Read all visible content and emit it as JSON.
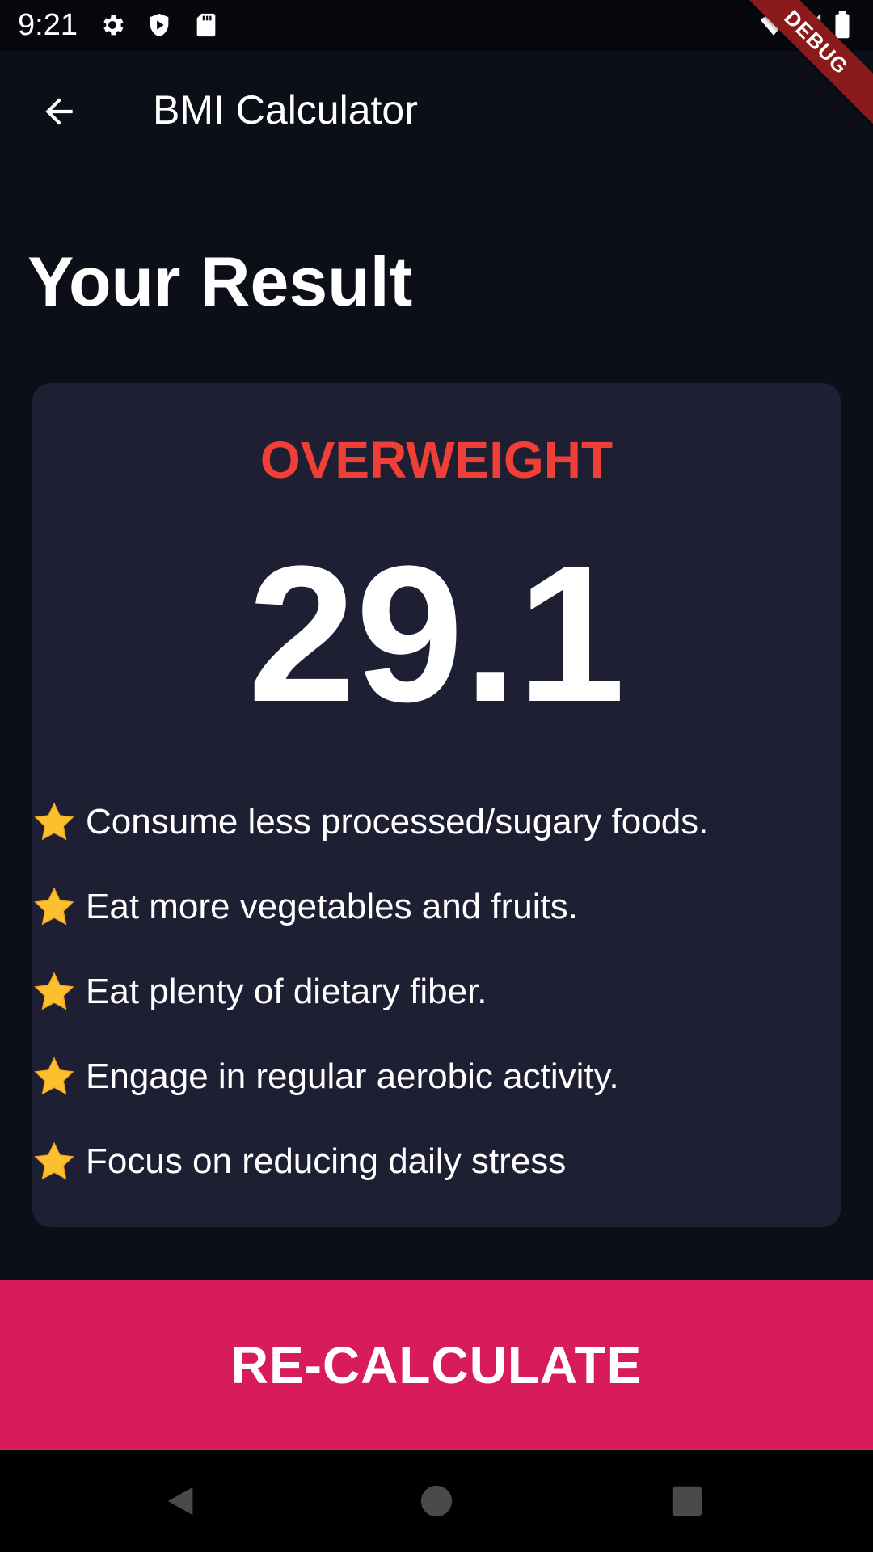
{
  "colors": {
    "background": "#0d0f18",
    "card": "#1e1f33",
    "category": "#ef3f36",
    "button": "#d81b5c",
    "text": "#ffffff"
  },
  "status_bar": {
    "time": "9:21",
    "icons": [
      "settings-icon",
      "shield-icon",
      "sd-card-icon",
      "wifi-icon",
      "signal-icon",
      "battery-icon"
    ]
  },
  "debug_banner": {
    "label": "DEBUG"
  },
  "app_bar": {
    "back_icon": "arrow-back-icon",
    "title": "BMI Calculator"
  },
  "page": {
    "title": "Your Result"
  },
  "result": {
    "category": "OVERWEIGHT",
    "bmi": "29.1",
    "tips": [
      {
        "icon": "star-icon",
        "text": "Consume less processed/sugary foods."
      },
      {
        "icon": "star-icon",
        "text": "Eat more vegetables and fruits."
      },
      {
        "icon": "star-icon",
        "text": "Eat plenty of dietary fiber."
      },
      {
        "icon": "star-icon",
        "text": "Engage in regular aerobic activity."
      },
      {
        "icon": "star-icon",
        "text": "Focus on reducing daily stress"
      }
    ]
  },
  "button": {
    "label": "RE-CALCULATE"
  },
  "nav_bar": {
    "icons": [
      "back-triangle-icon",
      "home-circle-icon",
      "recents-square-icon"
    ]
  }
}
